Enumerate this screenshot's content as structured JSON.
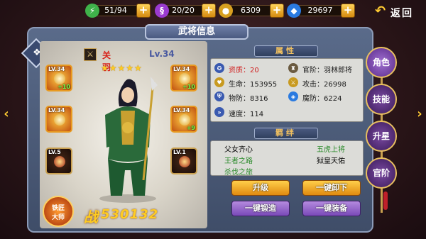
{
  "resources": [
    {
      "name": "stamina",
      "icon": "lightning-icon",
      "value": "51/94",
      "color": "#3fb24a"
    },
    {
      "name": "energy",
      "icon": "swirl-icon",
      "value": "20/20",
      "color": "#9a3ad0"
    },
    {
      "name": "gold",
      "icon": "coin-icon",
      "value": "6309",
      "color": "#d8a020"
    },
    {
      "name": "gems",
      "icon": "diamond-icon",
      "value": "29697",
      "color": "#2a7ae0"
    }
  ],
  "header": {
    "back_label": "返回",
    "title": "武将信息"
  },
  "hero": {
    "name": "关羽",
    "level": "Lv.34",
    "stars": "★★★★★",
    "power_prefix": "战",
    "power": "530132",
    "master_label_top": "铁匠",
    "master_label_bottom": "大师"
  },
  "equipment_left": [
    {
      "level": "LV.34",
      "plus": "+10",
      "style": "gold"
    },
    {
      "level": "LV.34",
      "plus": "",
      "style": "gold"
    },
    {
      "level": "LV.5",
      "plus": "",
      "style": "dark"
    }
  ],
  "equipment_right": [
    {
      "level": "LV.34",
      "plus": "+10",
      "style": "gold"
    },
    {
      "level": "LV.34",
      "plus": "+9",
      "style": "gold"
    },
    {
      "level": "LV.1",
      "plus": "",
      "style": "dark"
    }
  ],
  "attributes_header": "属性",
  "attributes": {
    "aptitude_label": "资质：",
    "aptitude_value": "20",
    "rank_label": "官阶：",
    "rank_value": "羽林郎将",
    "hp": "生命：153955",
    "attack": "攻击：26998",
    "pdef": "物防：8316",
    "mdef": "魔防：6224",
    "speed": "速度：114"
  },
  "fate_header": "羁绊",
  "fates": [
    {
      "text": "父女齐心",
      "color": "#2a2a2a"
    },
    {
      "text": "五虎上将",
      "color": "#2a8a2a"
    },
    {
      "text": "王者之路",
      "color": "#2a8a2a"
    },
    {
      "text": "狱皇天佑",
      "color": "#2a2a2a"
    },
    {
      "text": "杀伐之旅",
      "color": "#2a8a2a"
    }
  ],
  "buttons": {
    "upgrade": "升级",
    "unequip_all": "一键卸下",
    "forge_all": "一键锻造",
    "equip_all": "一键装备"
  },
  "side_tabs": [
    "角色",
    "技能",
    "升星",
    "官阶"
  ]
}
